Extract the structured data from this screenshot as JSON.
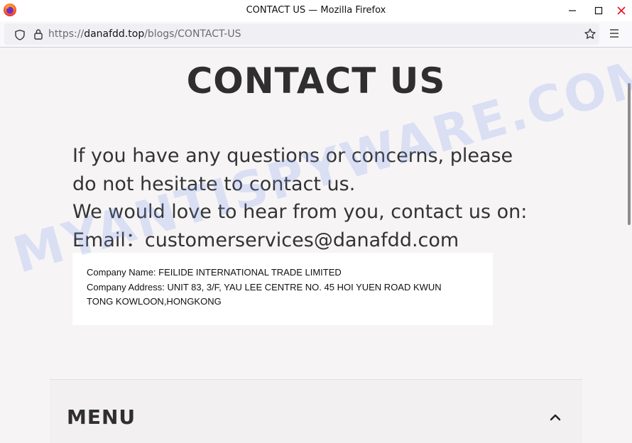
{
  "window": {
    "title": "CONTACT US — Mozilla Firefox"
  },
  "navbar": {
    "url_prefix": "https://",
    "url_domain": "danafdd.top",
    "url_path": "/blogs/CONTACT-US"
  },
  "page": {
    "heading": "CONTACT US",
    "lines": [
      "If you have any questions or concerns, please",
      "do not hesitate to contact us.",
      "We would love to hear from you, contact us on:",
      "Email：customerservices@danafdd.com"
    ],
    "company": {
      "name_line": "Company Name: FEILIDE INTERNATIONAL TRADE LIMITED",
      "address_line1": "Company Address: UNIT 83, 3/F, YAU LEE CENTRE NO. 45 HOI YUEN ROAD KWUN",
      "address_line2": "TONG KOWLOON,HONGKONG"
    },
    "menu_label": "MENU"
  },
  "watermark": "MYANTISPYWARE.COM",
  "icons": {
    "browser_logo": "firefox-icon",
    "minimize": "minimize-icon",
    "maximize": "maximize-icon",
    "close": "close-icon",
    "shield": "shield-icon",
    "lock": "lock-icon",
    "bookmark": "star-icon",
    "app_menu": "hamburger-menu-icon",
    "menu_toggle": "chevron-up-icon"
  },
  "colors": {
    "close_red": "#e81123",
    "page_bg": "#f6f4f5",
    "text_dark": "#2f2f2f",
    "watermark": "#7896eb"
  }
}
